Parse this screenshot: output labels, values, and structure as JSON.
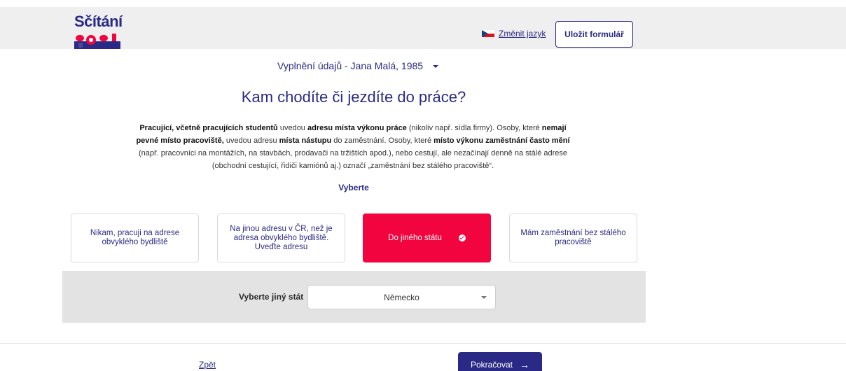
{
  "header": {
    "logo_text": "Sčítání",
    "logo_year": "2021",
    "language_link": "Změnit jazyk",
    "save_button": "Uložit formulář"
  },
  "person_select": {
    "label": "Vyplnění údajů - Jana Malá, 1985"
  },
  "question": {
    "title": "Kam chodíte či jezdíte do práce?",
    "description": [
      {
        "text": "Pracující, včetně pracujících studentů",
        "bold": true
      },
      {
        "text": " uvedou ",
        "bold": false
      },
      {
        "text": "adresu místa výkonu práce",
        "bold": true
      },
      {
        "text": " (nikoliv např. sídla firmy). Osoby, které ",
        "bold": false
      },
      {
        "text": "nemají pevné místo pracoviště,",
        "bold": true
      },
      {
        "text": " uvedou adresu ",
        "bold": false
      },
      {
        "text": "místa nástupu",
        "bold": true
      },
      {
        "text": " do zaměstnání. Osoby, které ",
        "bold": false
      },
      {
        "text": "místo výkonu zaměstnání často mění",
        "bold": true
      },
      {
        "text": " (např. pracovníci na montážích, na stavbách, prodavači na tržištích apod.), nebo cestují, ale nezačínají denně na stálé adrese (obchodní cestující, řidiči kamiónů aj.) označí „zaměstnání bez stálého pracoviště“.",
        "bold": false
      }
    ],
    "select_hint": "Vyberte"
  },
  "options": [
    {
      "label": "Nikam, pracuji na adrese obvyklého bydliště",
      "selected": false
    },
    {
      "label": "Na jinou adresu v ČR, než je adresa obvyklého bydliště. Uveďte adresu",
      "selected": false
    },
    {
      "label": "Do jiného státu",
      "selected": true
    },
    {
      "label": "Mám zaměstnání bez stálého pracoviště",
      "selected": false
    }
  ],
  "country": {
    "label": "Vyberte jiný stát",
    "value": "Německo"
  },
  "footer": {
    "back": "Zpět",
    "next": "Pokračovat",
    "next_arrow": "→"
  },
  "colors": {
    "primary": "#2a2a86",
    "accent": "#f2053e",
    "header_bg": "#efefef",
    "panel_bg": "#e3e3e3"
  }
}
